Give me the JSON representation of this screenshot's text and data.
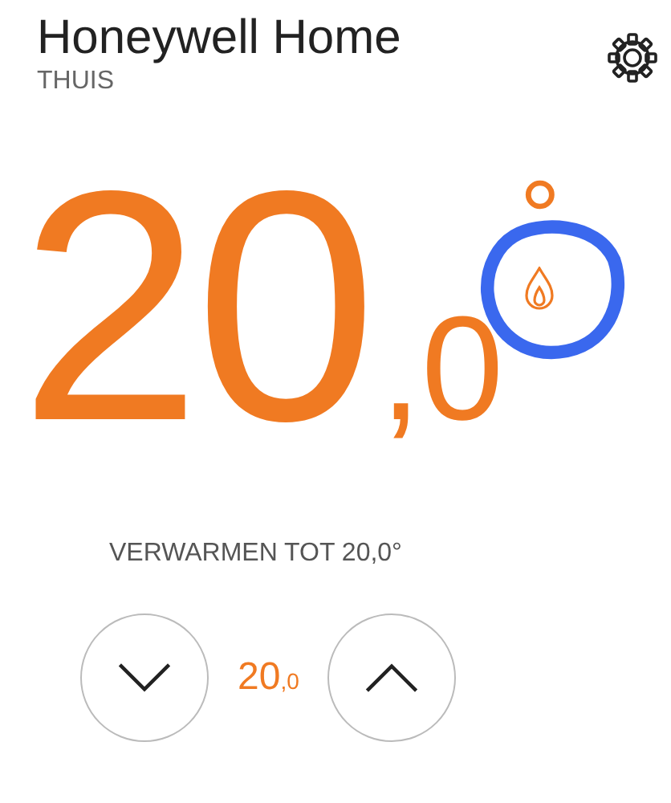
{
  "header": {
    "title": "Honeywell Home",
    "location": "THUIS"
  },
  "current_temperature": {
    "whole": "20",
    "decimal": ",0",
    "unit": "°",
    "heating": true
  },
  "annotation": {
    "kind": "circle"
  },
  "status": "VERWARMEN TOT 20,0°",
  "setpoint": {
    "whole": "20",
    "decimal": ",0"
  }
}
